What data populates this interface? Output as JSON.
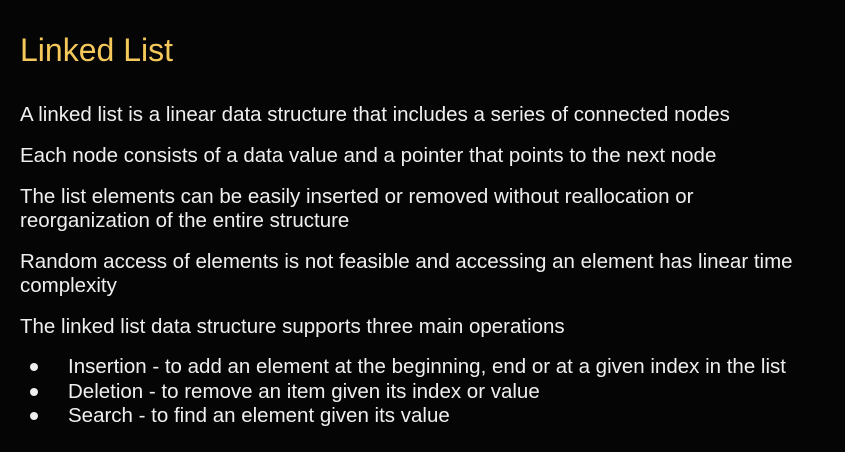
{
  "slide": {
    "title": "Linked List",
    "title_color": "#f4c85a",
    "background_color": "#050505",
    "paragraphs": {
      "p1": "A linked list is a linear data structure that includes a series of connected nodes",
      "p2": "Each node consists of a data value and a pointer that points to the next node",
      "p3_line1": "The list elements can be easily inserted or removed without reallocation or",
      "p3_line2": "reorganization of the entire structure",
      "p4_line1": "Random access of elements is not feasible and accessing an element has linear time",
      "p4_line2": "complexity",
      "p5": "The linked list data structure supports three main operations"
    },
    "bullets": [
      "Insertion - to add an element at the beginning, end or at a given index in the list",
      "Deletion - to remove an item given its index or value",
      "Search - to find an element given its value"
    ]
  }
}
